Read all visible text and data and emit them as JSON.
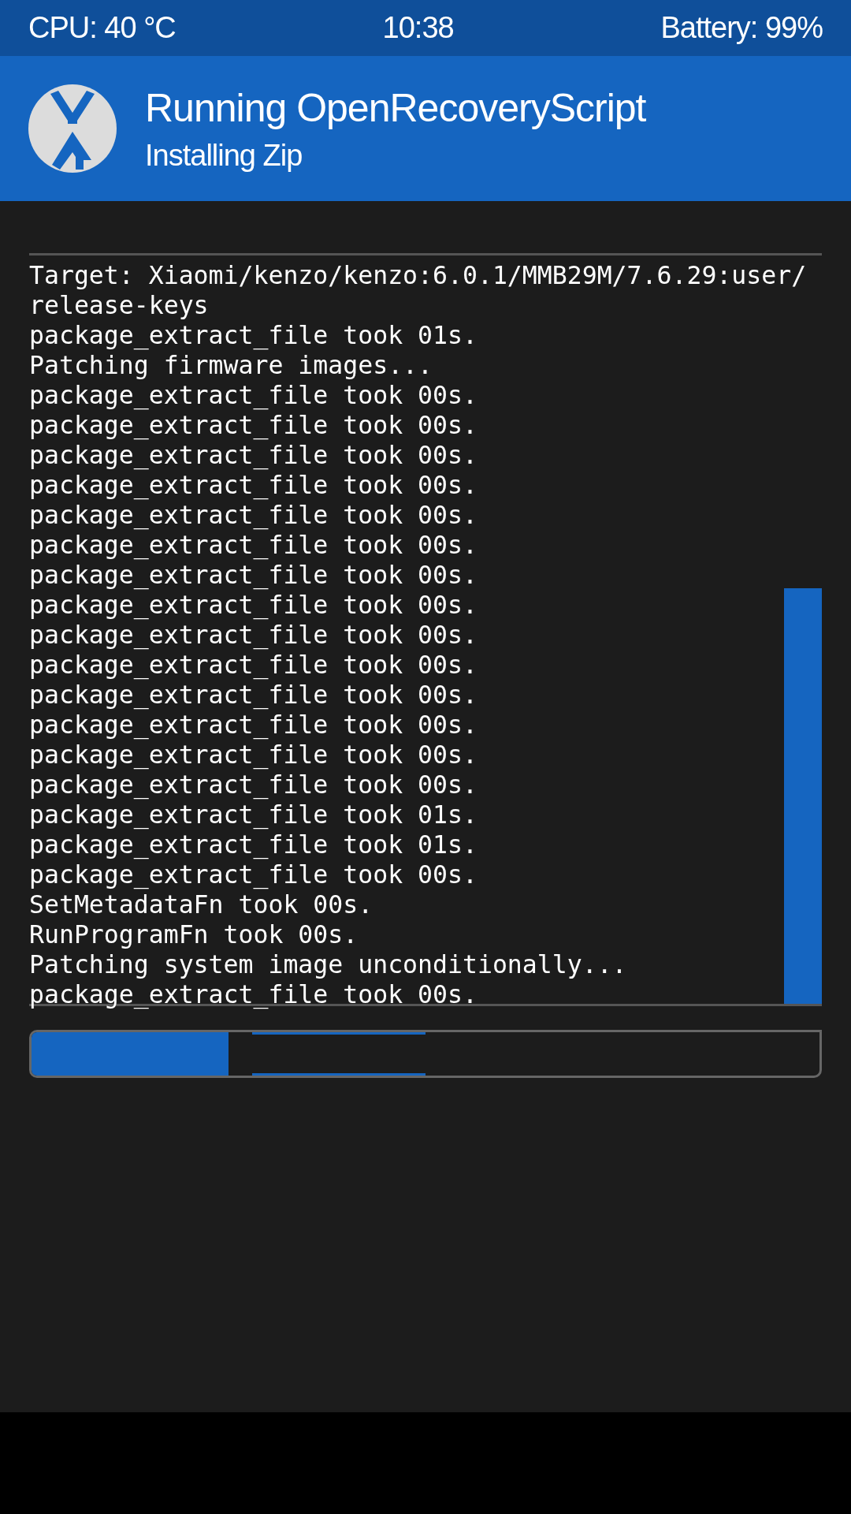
{
  "status_bar": {
    "cpu": "CPU: 40 °C",
    "time": "10:38",
    "battery": "Battery: 99%"
  },
  "header": {
    "title": "Running OpenRecoveryScript",
    "subtitle": "Installing Zip"
  },
  "console": {
    "lines": [
      "Target: Xiaomi/kenzo/kenzo:6.0.1/MMB29M/7.6.29:user/",
      "release-keys",
      "package_extract_file took 01s.",
      "Patching firmware images...",
      "package_extract_file took 00s.",
      "package_extract_file took 00s.",
      "package_extract_file took 00s.",
      "package_extract_file took 00s.",
      "package_extract_file took 00s.",
      "package_extract_file took 00s.",
      "package_extract_file took 00s.",
      "package_extract_file took 00s.",
      "package_extract_file took 00s.",
      "package_extract_file took 00s.",
      "package_extract_file took 00s.",
      "package_extract_file took 00s.",
      "package_extract_file took 00s.",
      "package_extract_file took 00s.",
      "package_extract_file took 01s.",
      "package_extract_file took 01s.",
      "package_extract_file took 00s.",
      "SetMetadataFn took 00s.",
      "RunProgramFn took 00s.",
      "Patching system image unconditionally...",
      "package_extract_file took 00s."
    ]
  },
  "progress": {
    "level": 0.25
  }
}
